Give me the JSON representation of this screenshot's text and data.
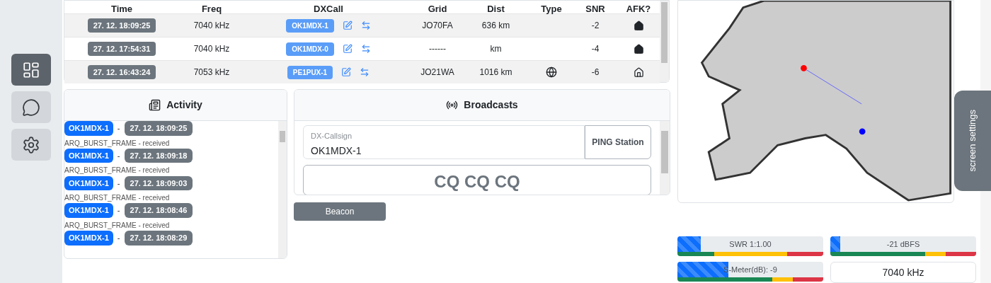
{
  "sidebar": {
    "items": [
      {
        "selected": true
      },
      {
        "selected": false
      },
      {
        "selected": false
      }
    ]
  },
  "heard_table": {
    "columns": [
      "Time",
      "Freq",
      "DXCall",
      "Grid",
      "Dist",
      "Type",
      "SNR",
      "AFK?"
    ],
    "rows": [
      {
        "time": "27. 12. 18:09:25",
        "freq": "7040 kHz",
        "dxcall": "OK1MDX-1",
        "grid": "JO70FA",
        "dist": "636 km",
        "type_globe": false,
        "snr": "-2",
        "afk": true
      },
      {
        "time": "27. 12. 17:54:31",
        "freq": "7040 kHz",
        "dxcall": "OK1MDX-0",
        "grid": "------",
        "dist": "km",
        "type_globe": false,
        "snr": "-4",
        "afk": true
      },
      {
        "time": "27. 12. 16:43:24",
        "freq": "7053 kHz",
        "dxcall": "PE1PUX-1",
        "grid": "JO21WA",
        "dist": "1016 km",
        "type_globe": true,
        "snr": "-6",
        "afk": false
      }
    ]
  },
  "activity": {
    "title": "Activity",
    "items": [
      {
        "callsign": "OK1MDX-1",
        "separator": "-",
        "time": "27. 12. 18:09:25",
        "message": "ARQ_BURST_FRAME - received"
      },
      {
        "callsign": "OK1MDX-1",
        "separator": "-",
        "time": "27. 12. 18:09:18",
        "message": "ARQ_BURST_FRAME - received"
      },
      {
        "callsign": "OK1MDX-1",
        "separator": "-",
        "time": "27. 12. 18:09:03",
        "message": "ARQ_BURST_FRAME - received"
      },
      {
        "callsign": "OK1MDX-1",
        "separator": "-",
        "time": "27. 12. 18:08:46",
        "message": "ARQ_BURST_FRAME - received"
      },
      {
        "callsign": "OK1MDX-1",
        "separator": "-",
        "time": "27. 12. 18:08:29"
      }
    ]
  },
  "broadcasts": {
    "title": "Broadcasts",
    "callsign_field": {
      "label": "DX-Callsign",
      "value": "OK1MDX-1"
    },
    "ping_button": "PING Station",
    "cq_button": "CQ CQ CQ",
    "beacon_button": "Beacon"
  },
  "screen_settings": "screen settings",
  "meters": [
    {
      "label": "SWR 1:1.00",
      "level": 0.16
    },
    {
      "label": "-21 dBFS",
      "level": 0.07
    },
    {
      "label": "S-Meter(dB): -9",
      "level": 0.35
    }
  ],
  "frequency": "7040 kHz"
}
